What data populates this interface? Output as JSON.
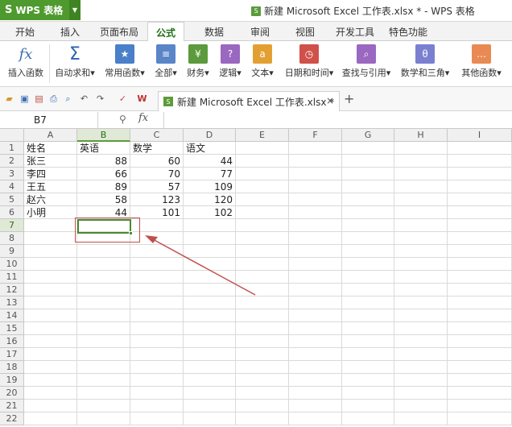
{
  "app": {
    "button_label": "WPS 表格",
    "logo_glyph": "S"
  },
  "window": {
    "title": "新建 Microsoft Excel 工作表.xlsx * - WPS 表格"
  },
  "tabs": [
    {
      "label": "开始"
    },
    {
      "label": "插入"
    },
    {
      "label": "页面布局"
    },
    {
      "label": "公式",
      "active": true
    },
    {
      "label": "数据"
    },
    {
      "label": "审阅"
    },
    {
      "label": "视图"
    },
    {
      "label": "开发工具"
    },
    {
      "label": "特色功能"
    }
  ],
  "ribbon": {
    "insert_function": "插入函数",
    "autosum": "自动求和",
    "common_functions": "常用函数",
    "all": "全部",
    "finance": "财务",
    "logic": "逻辑",
    "text": "文本",
    "datetime": "日期和时间",
    "lookup": "查找与引用",
    "math": "数学和三角",
    "other": "其他函数"
  },
  "file_tab": {
    "label": "新建 Microsoft Excel 工作表.xlsx *"
  },
  "formula_bar": {
    "name_box": "B7",
    "fx": "fx",
    "value": ""
  },
  "sheet": {
    "columns": [
      "A",
      "B",
      "C",
      "D",
      "E",
      "F",
      "G",
      "H",
      "I"
    ],
    "rows": [
      "1",
      "2",
      "3",
      "4",
      "5",
      "6",
      "7",
      "8",
      "9",
      "10",
      "11",
      "12",
      "13",
      "14",
      "15",
      "16",
      "17",
      "18",
      "19",
      "20",
      "21",
      "22"
    ],
    "selected_cell": "B7",
    "headers": {
      "name": "姓名",
      "english": "英语",
      "math": "数学",
      "chinese": "语文"
    },
    "data": [
      {
        "name": "张三",
        "english": "88",
        "math": "60",
        "chinese": "44"
      },
      {
        "name": "李四",
        "english": "66",
        "math": "70",
        "chinese": "77"
      },
      {
        "name": "王五",
        "english": "89",
        "math": "57",
        "chinese": "109"
      },
      {
        "name": "赵六",
        "english": "58",
        "math": "123",
        "chinese": "120"
      },
      {
        "name": "小明",
        "english": "44",
        "math": "101",
        "chinese": "102"
      }
    ]
  },
  "colors": {
    "accent": "#4e9a2e",
    "annotation": "#c0504d"
  }
}
